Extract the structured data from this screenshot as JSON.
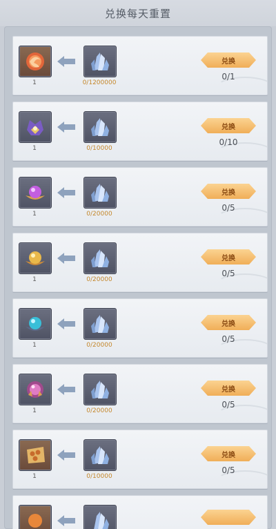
{
  "header": {
    "title": "兑换每天重置"
  },
  "exchange_button_label": "兑换",
  "rows": [
    {
      "reward_icon": "fire-orb-icon",
      "reward_count": "1",
      "cost_count": "0/1200000",
      "progress": "0/1"
    },
    {
      "reward_icon": "purple-helmet-icon",
      "reward_count": "1",
      "cost_count": "0/10000",
      "progress": "0/10"
    },
    {
      "reward_icon": "purple-pearl-icon",
      "reward_count": "1",
      "cost_count": "0/20000",
      "progress": "0/5"
    },
    {
      "reward_icon": "gold-pearl-icon",
      "reward_count": "1",
      "cost_count": "0/20000",
      "progress": "0/5"
    },
    {
      "reward_icon": "cyan-pearl-icon",
      "reward_count": "1",
      "cost_count": "0/20000",
      "progress": "0/5"
    },
    {
      "reward_icon": "magic-orb-icon",
      "reward_count": "1",
      "cost_count": "0/20000",
      "progress": "0/5"
    },
    {
      "reward_icon": "treasure-map-icon",
      "reward_count": "1",
      "cost_count": "0/10000",
      "progress": "0/5"
    }
  ],
  "colors": {
    "button_top": "#fbd391",
    "button_bottom": "#f0ae58",
    "cost_text": "#c4872b"
  }
}
